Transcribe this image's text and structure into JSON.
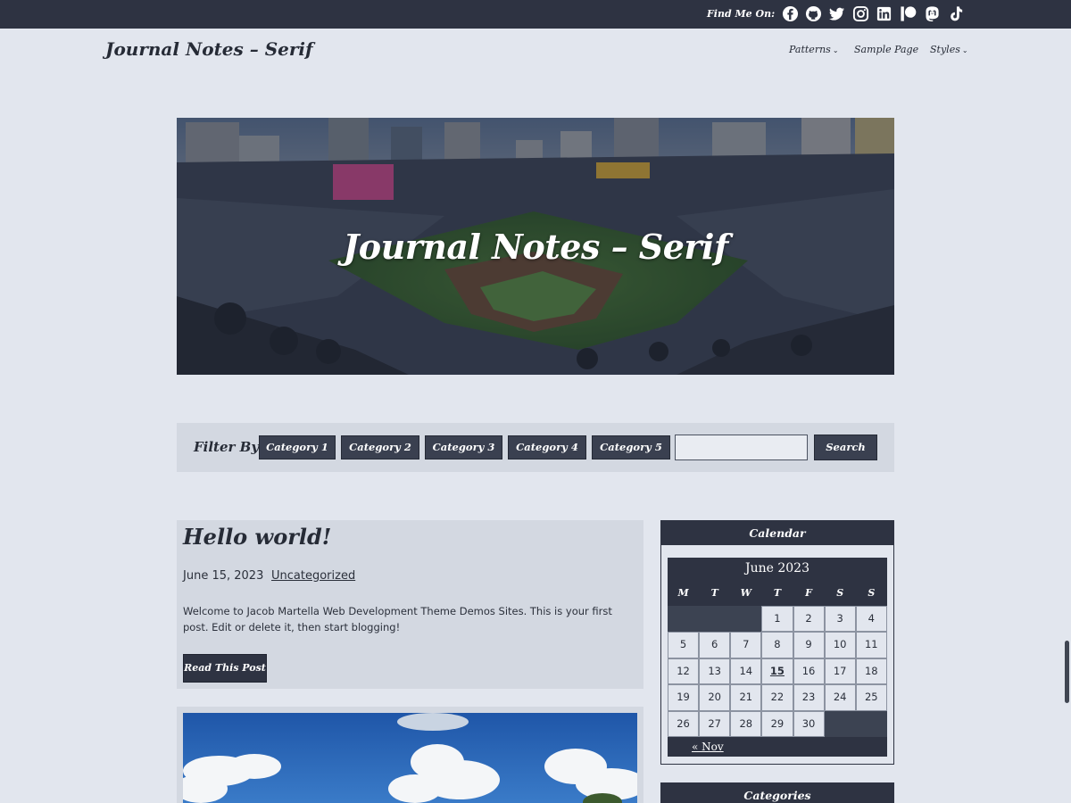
{
  "topbar": {
    "find_label": "Find Me On:",
    "social_icons": [
      "facebook-icon",
      "github-icon",
      "twitter-icon",
      "instagram-icon",
      "linkedin-icon",
      "patreon-icon",
      "mastodon-icon",
      "tiktok-icon"
    ]
  },
  "header": {
    "site_title": "Journal Notes – Serif",
    "nav": [
      {
        "label": "Patterns",
        "has_dropdown": true
      },
      {
        "label": "Sample Page",
        "has_dropdown": false
      },
      {
        "label": "Styles",
        "has_dropdown": true
      }
    ]
  },
  "hero": {
    "title": "Journal Notes – Serif"
  },
  "filter": {
    "label": "Filter By:",
    "categories": [
      "Category 1",
      "Category 2",
      "Category 3",
      "Category 4",
      "Category 5"
    ],
    "search_value": "",
    "search_button": "Search"
  },
  "post": {
    "title": "Hello world!",
    "date": "June 15, 2023",
    "category": "Uncategorized",
    "excerpt": "Welcome to Jacob Martella Web Development Theme Demos Sites. This is your first post. Edit or delete it, then start blogging!",
    "read_more": "Read This Post"
  },
  "calendar_widget": {
    "heading": "Calendar",
    "month": "June 2023",
    "weekdays": [
      "M",
      "T",
      "W",
      "T",
      "F",
      "S",
      "S"
    ],
    "weeks": [
      [
        "",
        "",
        "",
        "1",
        "2",
        "3",
        "4"
      ],
      [
        "5",
        "6",
        "7",
        "8",
        "9",
        "10",
        "11"
      ],
      [
        "12",
        "13",
        "14",
        "15",
        "16",
        "17",
        "18"
      ],
      [
        "19",
        "20",
        "21",
        "22",
        "23",
        "24",
        "25"
      ],
      [
        "26",
        "27",
        "28",
        "29",
        "30",
        "",
        ""
      ]
    ],
    "today": "15",
    "prev_link": "« Nov"
  },
  "categories_widget": {
    "heading": "Categories"
  },
  "colors": {
    "dark": "#2e3342",
    "background": "#e2e6ee",
    "card": "#d3d8e1"
  }
}
